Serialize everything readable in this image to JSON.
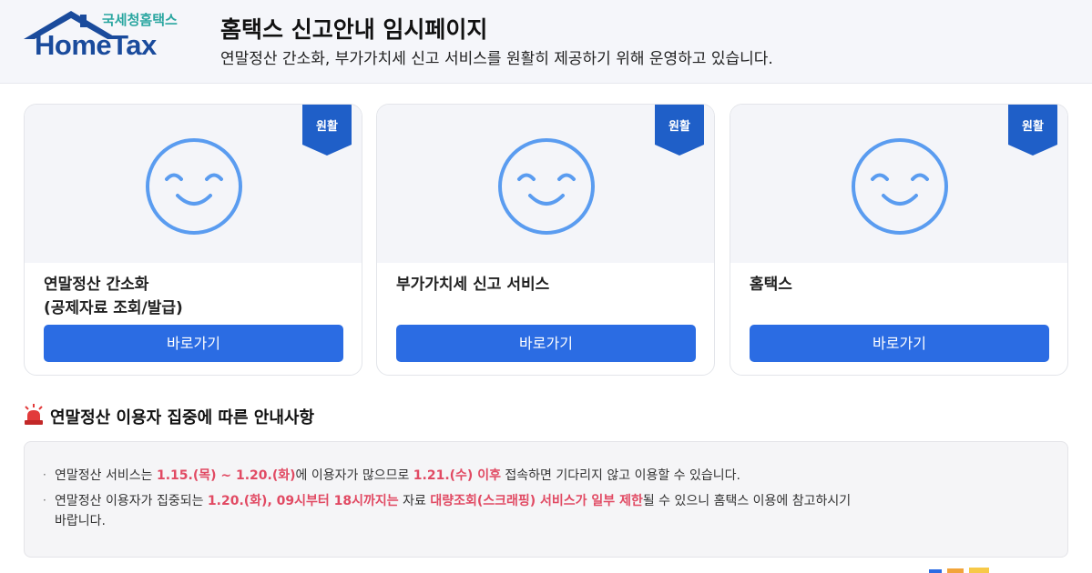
{
  "logo": {
    "sub_text": "국세청홈택스",
    "main_text": "HomeTax"
  },
  "header": {
    "title": "홈택스 신고안내 임시페이지",
    "description": "연말정산 간소화, 부가가치세 신고 서비스를 원활히 제공하기 위해 운영하고 있습니다."
  },
  "cards": [
    {
      "status": "원활",
      "title_line1": "연말정산 간소화",
      "title_line2": "(공제자료 조회/발급)",
      "button": "바로가기"
    },
    {
      "status": "원활",
      "title_line1": "부가가치세 신고 서비스",
      "title_line2": "",
      "button": "바로가기"
    },
    {
      "status": "원활",
      "title_line1": "홈택스",
      "title_line2": "",
      "button": "바로가기"
    }
  ],
  "notice": {
    "title": "연말정산 이용자 집중에 따른 안내사항",
    "bullet": "·",
    "line1": {
      "p1": "연말정산 서비스는 ",
      "h1": "1.15.(목) ~ 1.20.(화)",
      "p2": "에 이용자가 많으므로 ",
      "h2": "1.21.(수) 이후",
      "p3": " 접속하면 기다리지 않고 이용할 수 있습니다."
    },
    "line2": {
      "p1": "연말정산 이용자가 집중되는 ",
      "h1": "1.20.(화), 09시부터 18시까지는",
      "p2": " 자료 ",
      "h2": "대량조회(스크래핑) 서비스가 일부 제한",
      "p3": "될 수 있으니 홈택스 이용에 참고하시기",
      "p4": "바랍니다."
    }
  },
  "colors": {
    "primary_button": "#2b6ce3",
    "ribbon": "#1f5fc8",
    "smile": "#5a9cf0",
    "highlight": "#e14a63",
    "alarm": "#e23b3b"
  },
  "icons": {
    "status_face": "smile-icon",
    "notice": "alarm-siren-icon",
    "logo": "house-roof-icon"
  }
}
